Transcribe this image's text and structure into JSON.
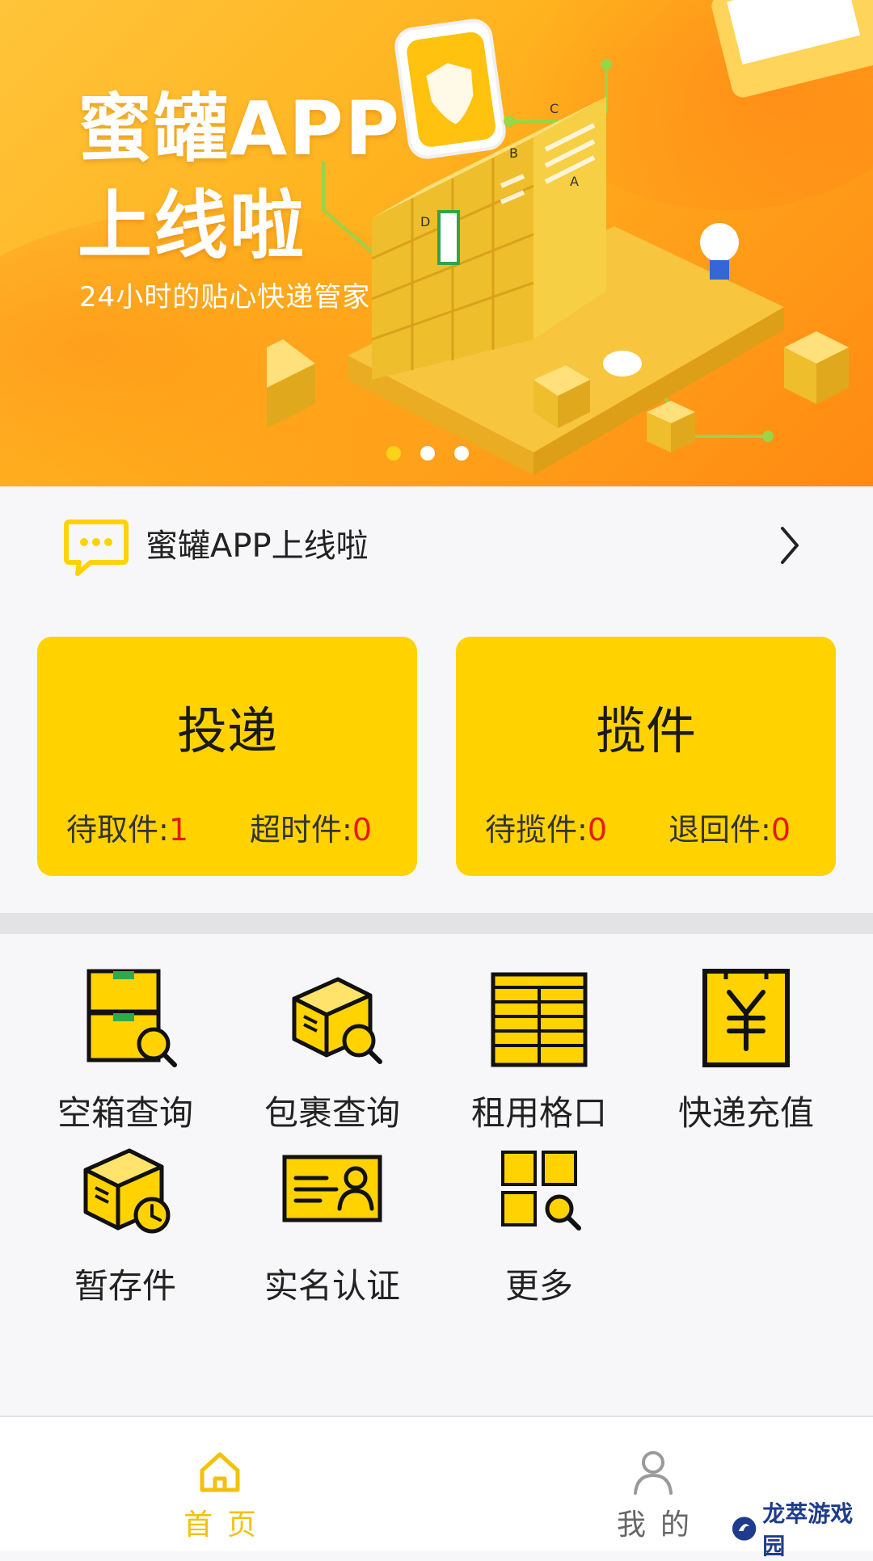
{
  "banner": {
    "title_line1": "蜜罐APP",
    "title_line2": "上线啦",
    "subtitle": "24小时的贴心快递管家",
    "locker_labels": [
      "D",
      "A",
      "B",
      "C"
    ],
    "slides": 3,
    "active_slide": 1
  },
  "notice": {
    "text": "蜜罐APP上线啦",
    "icon": "message-icon",
    "arrow": "chevron-right-icon"
  },
  "cards": [
    {
      "title": "投递",
      "stats": [
        {
          "label": "待取件:",
          "value": "1"
        },
        {
          "label": "超时件:",
          "value": "0"
        }
      ]
    },
    {
      "title": "揽件",
      "stats": [
        {
          "label": "待揽件:",
          "value": "0"
        },
        {
          "label": "退回件:",
          "value": "0"
        }
      ]
    }
  ],
  "grid": [
    {
      "label": "空箱查询",
      "icon": "empty-box-search-icon"
    },
    {
      "label": "包裹查询",
      "icon": "package-search-icon"
    },
    {
      "label": "租用格口",
      "icon": "locker-grid-icon"
    },
    {
      "label": "快递充值",
      "icon": "yuan-recharge-icon"
    },
    {
      "label": "暂存件",
      "icon": "package-clock-icon"
    },
    {
      "label": "实名认证",
      "icon": "id-card-icon"
    },
    {
      "label": "更多",
      "icon": "more-grid-icon"
    }
  ],
  "tabbar": {
    "home_label": "首页",
    "mine_label": "我的",
    "active": "home"
  },
  "watermark": {
    "text": "龙萃游戏园"
  },
  "colors": {
    "accent_yellow": "#ffd200",
    "stat_red": "#e8190b",
    "tab_active": "#f2c20a",
    "banner_orange": "#ffb31f"
  }
}
